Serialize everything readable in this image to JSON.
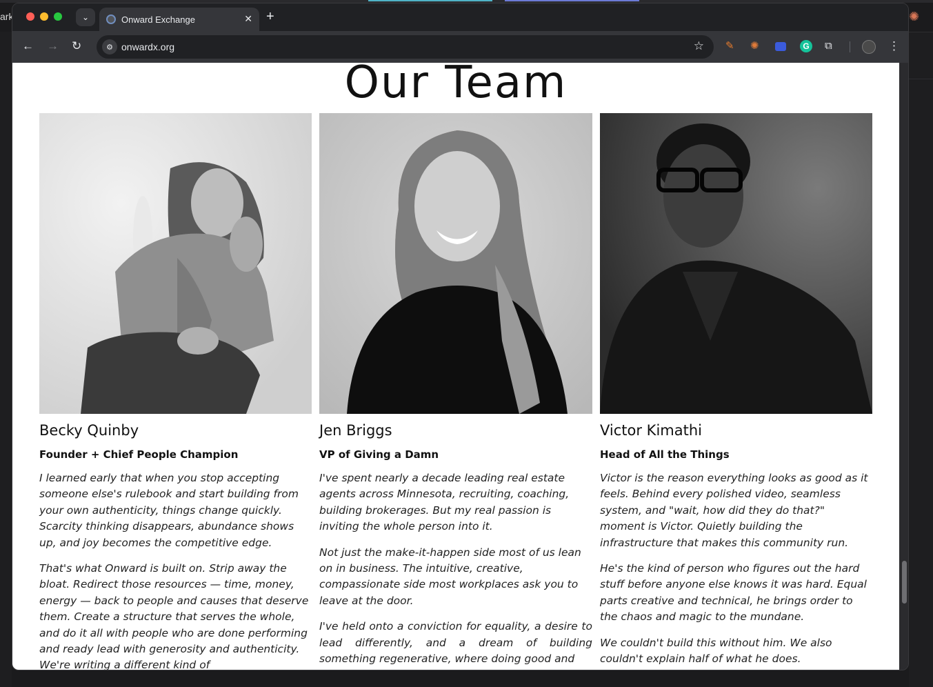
{
  "desktop": {
    "left_text": "arke"
  },
  "browser": {
    "tab_title": "Onward Exchange",
    "url": "onwardx.org"
  },
  "page": {
    "title": "Our Team",
    "members": [
      {
        "name": "Becky Quinby",
        "role": "Founder + Chief People Champion",
        "bio": [
          "I learned early that when you stop accepting someone else's rulebook and start building from your own authenticity, things change quickly. Scarcity thinking disappears, abundance shows up, and joy becomes the competitive edge.",
          "That's what Onward is built on. Strip away the bloat. Redirect those resources — time, money, energy — back to people and causes that deserve them. Create a structure that serves the whole, and do it all with people who are done performing and ready lead with generosity and authenticity. We're writing a different kind of"
        ]
      },
      {
        "name": "Jen Briggs",
        "role": "VP of Giving a Damn",
        "bio": [
          "I've spent nearly a decade leading real estate agents across Minnesota, recruiting, coaching, building brokerages. But my real passion is inviting the whole person into it.",
          "Not just the make-it-happen side most of us lean on in business. The intuitive, creative, compassionate side most workplaces ask you to leave at the door.",
          "I've held onto a conviction for equality, a desire to lead differently, and a dream of building something regenerative, where doing good and"
        ]
      },
      {
        "name": "Victor Kimathi",
        "role": "Head of All the Things",
        "bio": [
          "Victor is the reason everything looks as good as it feels. Behind every polished video, seamless system, and \"wait, how did they do that?\" moment is Victor. Quietly building the infrastructure that makes this community run.",
          "He's the kind of person who figures out the hard stuff before anyone else knows it was hard. Equal parts creative and technical, he brings order to the chaos and magic to the mundane.",
          "We couldn't build this without him. We also couldn't explain half of what he does."
        ]
      }
    ]
  }
}
